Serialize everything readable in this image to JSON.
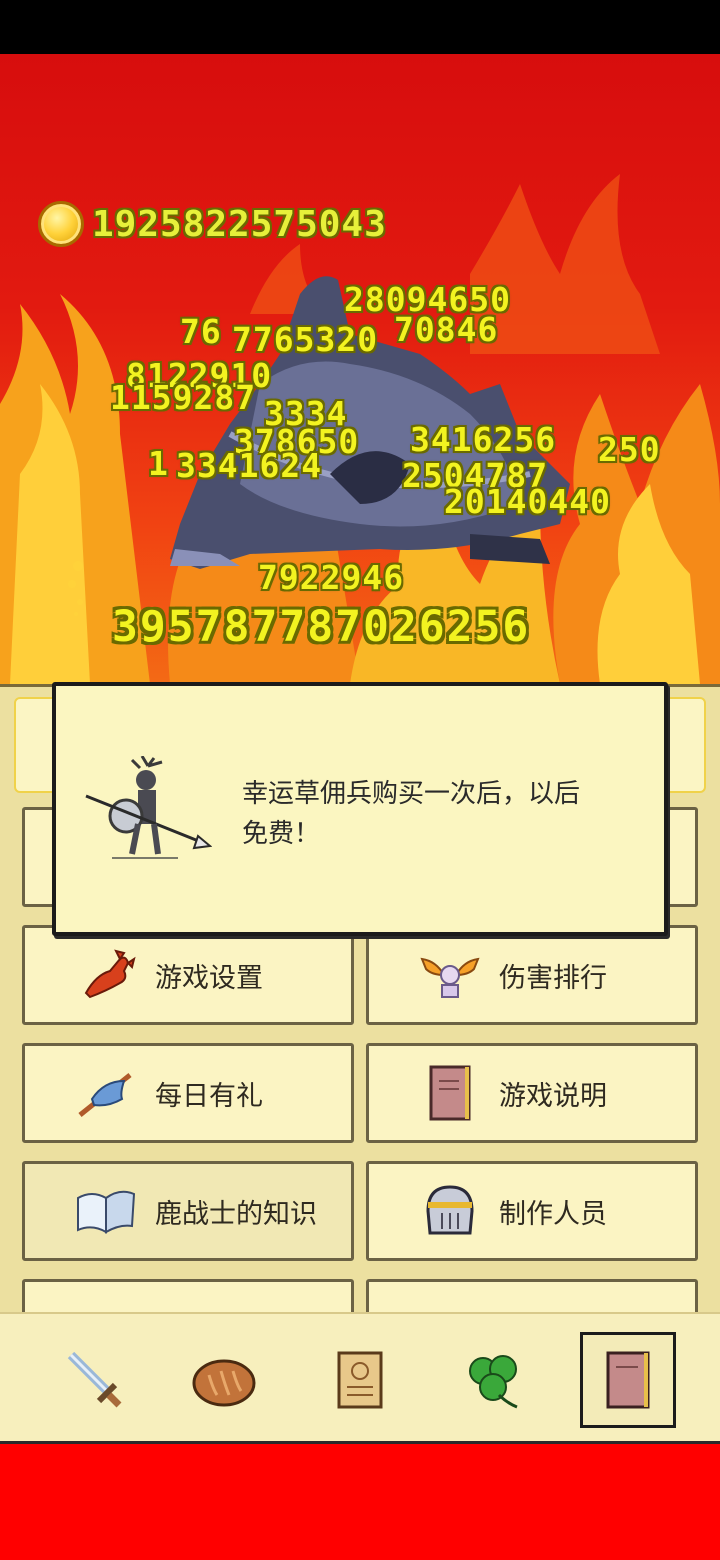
{
  "header": {
    "gold": "1925822575043"
  },
  "damage_numbers": [
    "28094650",
    "76",
    "7765320",
    "70846",
    "8122910",
    "1159287",
    "3334",
    "378650",
    "3416256",
    "250",
    "1",
    "3341624",
    "2504787",
    "20140440",
    "7922946"
  ],
  "total_damage": "39578778702625​6",
  "tip": {
    "text_line1": "幸运草佣兵购买一次后，以后",
    "text_line2": "免费！"
  },
  "menu": [
    {
      "label": "游戏设置",
      "icon": "lobster-icon"
    },
    {
      "label": "伤害排行",
      "icon": "winged-trophy-icon"
    },
    {
      "label": "每日有礼",
      "icon": "fish-skewer-icon"
    },
    {
      "label": "游戏说明",
      "icon": "guide-book-icon"
    },
    {
      "label": "鹿战士的知识",
      "icon": "open-book-icon"
    },
    {
      "label": "制作人员",
      "icon": "knight-helmet-icon"
    }
  ],
  "bottom_nav": [
    {
      "name": "sword",
      "icon": "sword-icon"
    },
    {
      "name": "bread",
      "icon": "bread-icon"
    },
    {
      "name": "scroll",
      "icon": "scroll-icon"
    },
    {
      "name": "clover",
      "icon": "clover-icon"
    },
    {
      "name": "book",
      "icon": "book-icon"
    }
  ],
  "colors": {
    "damage_text": "#f3f320",
    "panel_bg": "#fbf4c3",
    "game_bg": "#e21a10"
  }
}
